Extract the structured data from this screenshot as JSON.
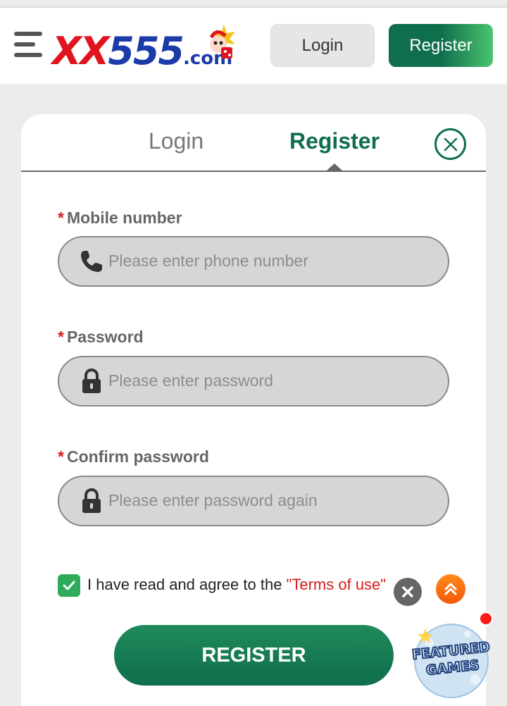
{
  "header": {
    "logo": {
      "brand_letters": "XX",
      "brand_number": "555",
      "brand_suffix": ".com"
    },
    "login_label": "Login",
    "register_label": "Register"
  },
  "modal": {
    "tabs": [
      {
        "label": "Login",
        "active": false
      },
      {
        "label": "Register",
        "active": true
      }
    ],
    "fields": [
      {
        "label": "Mobile number",
        "required_mark": "*",
        "placeholder": "Please enter phone number",
        "icon": "phone-icon"
      },
      {
        "label": "Password",
        "required_mark": "*",
        "placeholder": "Please enter password",
        "icon": "lock-icon"
      },
      {
        "label": "Confirm password",
        "required_mark": "*",
        "placeholder": "Please enter password again",
        "icon": "lock-icon"
      }
    ],
    "agree": {
      "checked": true,
      "text": "I have read and agree to the ",
      "link": "\"Terms of use\""
    },
    "submit_label": "REGISTER"
  },
  "floating": {
    "featured_text": "FEATURED GAMES",
    "icons": [
      "close-icon",
      "double-chevron-up-icon"
    ]
  },
  "colors": {
    "brand_green": "#0f6e4c",
    "required_red": "#d61e1e",
    "checkbox_green": "#2faa5a",
    "scroll_orange": "#f25a0a"
  }
}
